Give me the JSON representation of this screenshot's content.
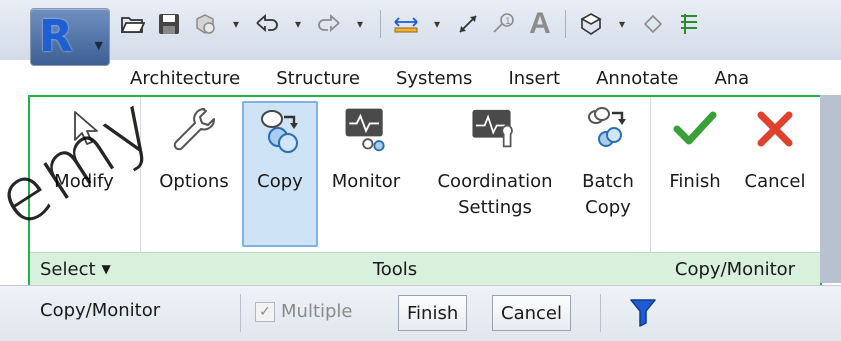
{
  "app": {
    "logo_letter": "R"
  },
  "qat": {
    "icons": [
      "open-folder-icon",
      "save-icon",
      "sync-icon",
      "undo-icon",
      "redo-icon",
      "measure-icon",
      "aligned-dimension-icon",
      "tag-icon",
      "text-icon",
      "3d-view-icon",
      "section-icon",
      "thin-lines-icon"
    ]
  },
  "tabs": [
    "Architecture",
    "Structure",
    "Systems",
    "Insert",
    "Annotate",
    "Ana"
  ],
  "ribbon": {
    "select_panel": {
      "button_label": "Modify",
      "footer_label": "Select"
    },
    "tools_panel": {
      "buttons": [
        {
          "label": "Options"
        },
        {
          "label": "Copy"
        },
        {
          "label": "Monitor"
        },
        {
          "label": "Coordination\nSettings"
        },
        {
          "label": "Batch\nCopy"
        }
      ],
      "footer_label": "Tools"
    },
    "copy_monitor_panel": {
      "buttons": [
        {
          "label": "Finish"
        },
        {
          "label": "Cancel"
        }
      ],
      "footer_label": "Copy/Monitor"
    }
  },
  "options_bar": {
    "title": "Copy/Monitor",
    "multiple_label": "Multiple",
    "finish_label": "Finish",
    "cancel_label": "Cancel"
  },
  "colors": {
    "accent_green": "#1fb44b",
    "panel_footer": "#d8f0dc",
    "active_button": "#cfe3f6",
    "filter_blue": "#1e5bd6",
    "finish_green": "#3aa03a",
    "cancel_red": "#e0412f"
  },
  "watermark": "emy"
}
